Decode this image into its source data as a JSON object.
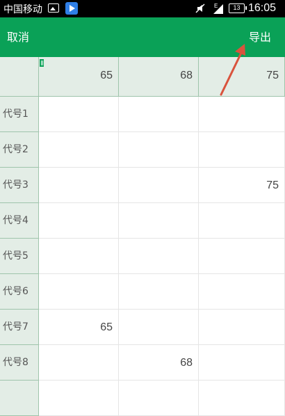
{
  "status_bar": {
    "carrier": "中国移动",
    "network_type": "E",
    "battery": "13",
    "time": "16:05",
    "icons": [
      "image-icon",
      "play-store-icon",
      "mute-icon",
      "signal-icon",
      "battery-icon"
    ]
  },
  "app_bar": {
    "cancel_label": "取消",
    "export_label": "导出",
    "color": "#0aa157"
  },
  "spreadsheet": {
    "column_headers": [
      "65",
      "68",
      "75"
    ],
    "rows": [
      {
        "label": "代号1",
        "cells": [
          "",
          "",
          ""
        ]
      },
      {
        "label": "代号2",
        "cells": [
          "",
          "",
          ""
        ]
      },
      {
        "label": "代号3",
        "cells": [
          "",
          "",
          "75"
        ]
      },
      {
        "label": "代号4",
        "cells": [
          "",
          "",
          ""
        ]
      },
      {
        "label": "代号5",
        "cells": [
          "",
          "",
          ""
        ]
      },
      {
        "label": "代号6",
        "cells": [
          "",
          "",
          ""
        ]
      },
      {
        "label": "代号7",
        "cells": [
          "65",
          "",
          ""
        ]
      },
      {
        "label": "代号8",
        "cells": [
          "",
          "68",
          ""
        ]
      },
      {
        "label": "",
        "cells": [
          "",
          "",
          ""
        ]
      }
    ]
  },
  "annotation": {
    "type": "arrow",
    "points_to": "export-button",
    "color": "#d9533d"
  }
}
